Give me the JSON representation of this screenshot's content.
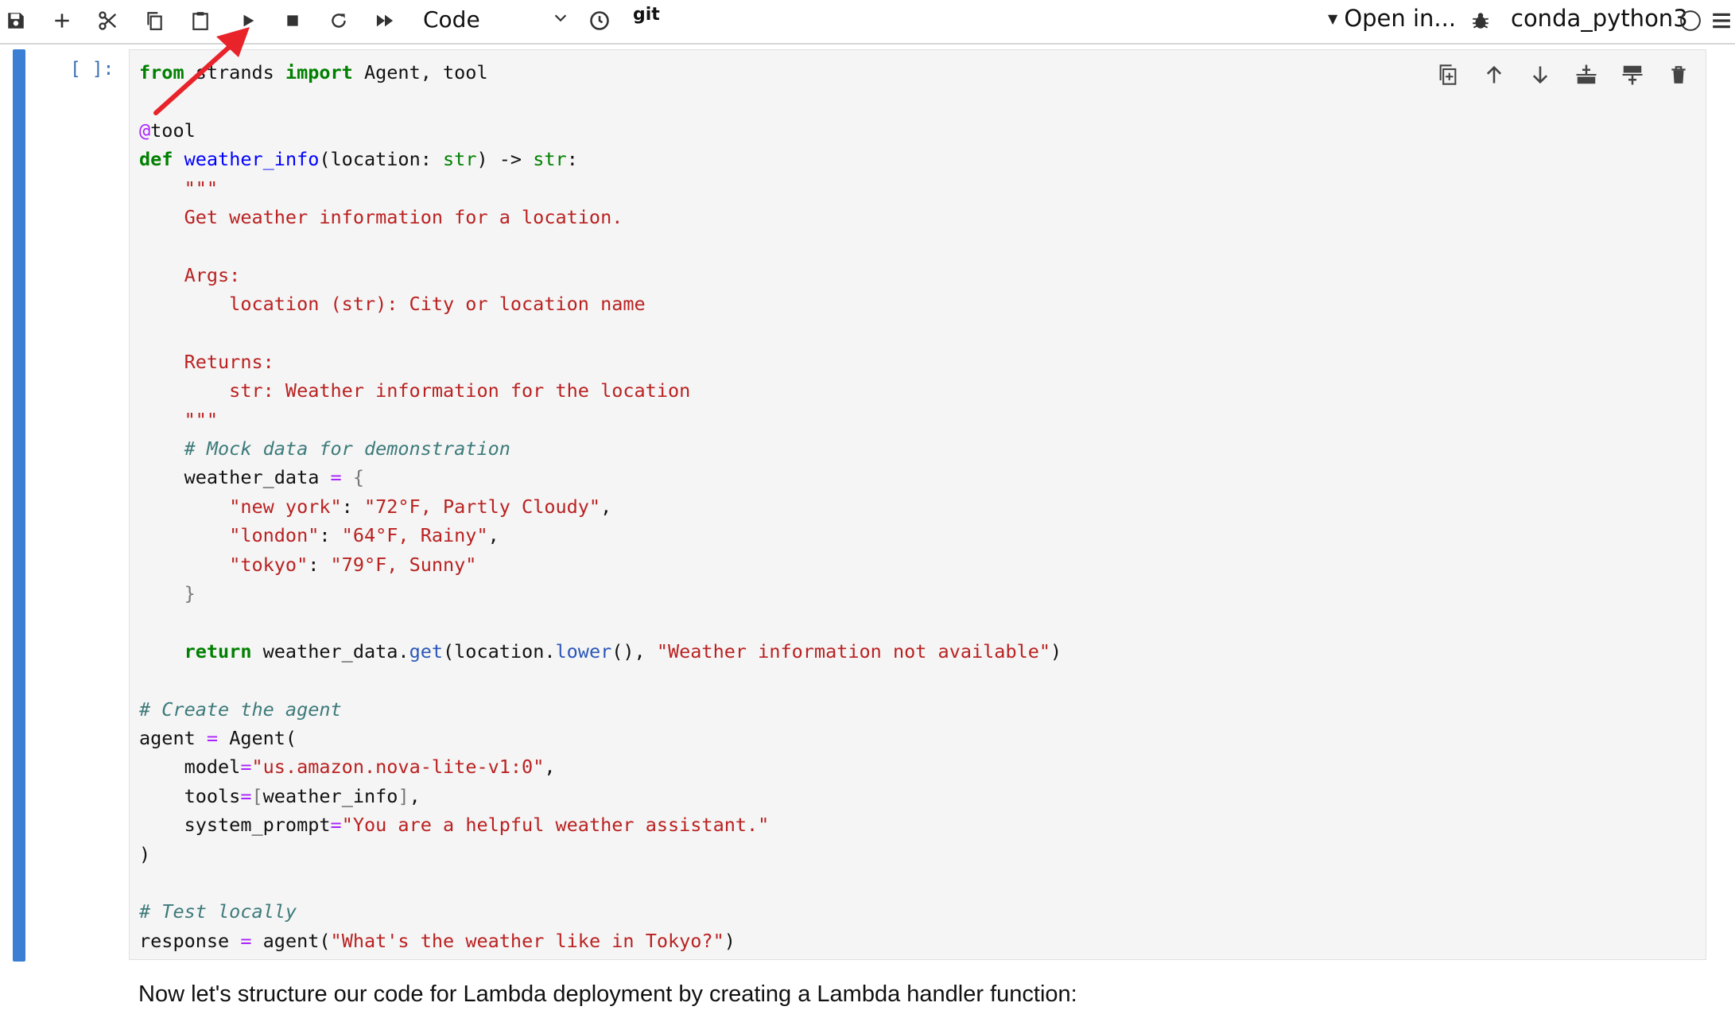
{
  "toolbar": {
    "icons": [
      "save-icon",
      "add-cell-icon",
      "cut-icon",
      "copy-icon",
      "paste-icon",
      "run-icon",
      "stop-icon",
      "restart-icon",
      "run-all-icon"
    ],
    "cell_type": "Code",
    "history_icon": "clock-icon",
    "git_label": "git",
    "open_in_label": "Open in...",
    "debug_icon": "bug-icon",
    "kernel_name": "conda_python3",
    "kernel_status_icon": "kernel-idle-circle-icon",
    "menu_icon": "hamburger-icon"
  },
  "cell": {
    "prompt": "[ ]:",
    "actions": [
      "duplicate-cell-icon",
      "move-up-icon",
      "move-down-icon",
      "insert-below-icon",
      "insert-above-icon",
      "delete-icon"
    ],
    "code_lines": [
      "from strands import Agent, tool",
      "",
      "@tool",
      "def weather_info(location: str) -> str:",
      "    \"\"\"",
      "    Get weather information for a location.",
      "",
      "    Args:",
      "        location (str): City or location name",
      "",
      "    Returns:",
      "        str: Weather information for the location",
      "    \"\"\"",
      "    # Mock data for demonstration",
      "    weather_data = {",
      "        \"new york\": \"72°F, Partly Cloudy\",",
      "        \"london\": \"64°F, Rainy\",",
      "        \"tokyo\": \"79°F, Sunny\"",
      "    }",
      "",
      "    return weather_data.get(location.lower(), \"Weather information not available\")",
      "",
      "# Create the agent",
      "agent = Agent(",
      "    model=\"us.amazon.nova-lite-v1:0\",",
      "    tools=[weather_info],",
      "    system_prompt=\"You are a helpful weather assistant.\"",
      ")",
      "",
      "# Test locally",
      "response = agent(\"What's the weather like in Tokyo?\")"
    ]
  },
  "markdown": {
    "text": "Now let's structure our code for Lambda deployment by creating a Lambda handler function:"
  },
  "annotation": {
    "color": "#e8232a"
  },
  "colors": {
    "cell_bar": "#3b7fd4",
    "editor_bg": "#f5f5f5"
  }
}
